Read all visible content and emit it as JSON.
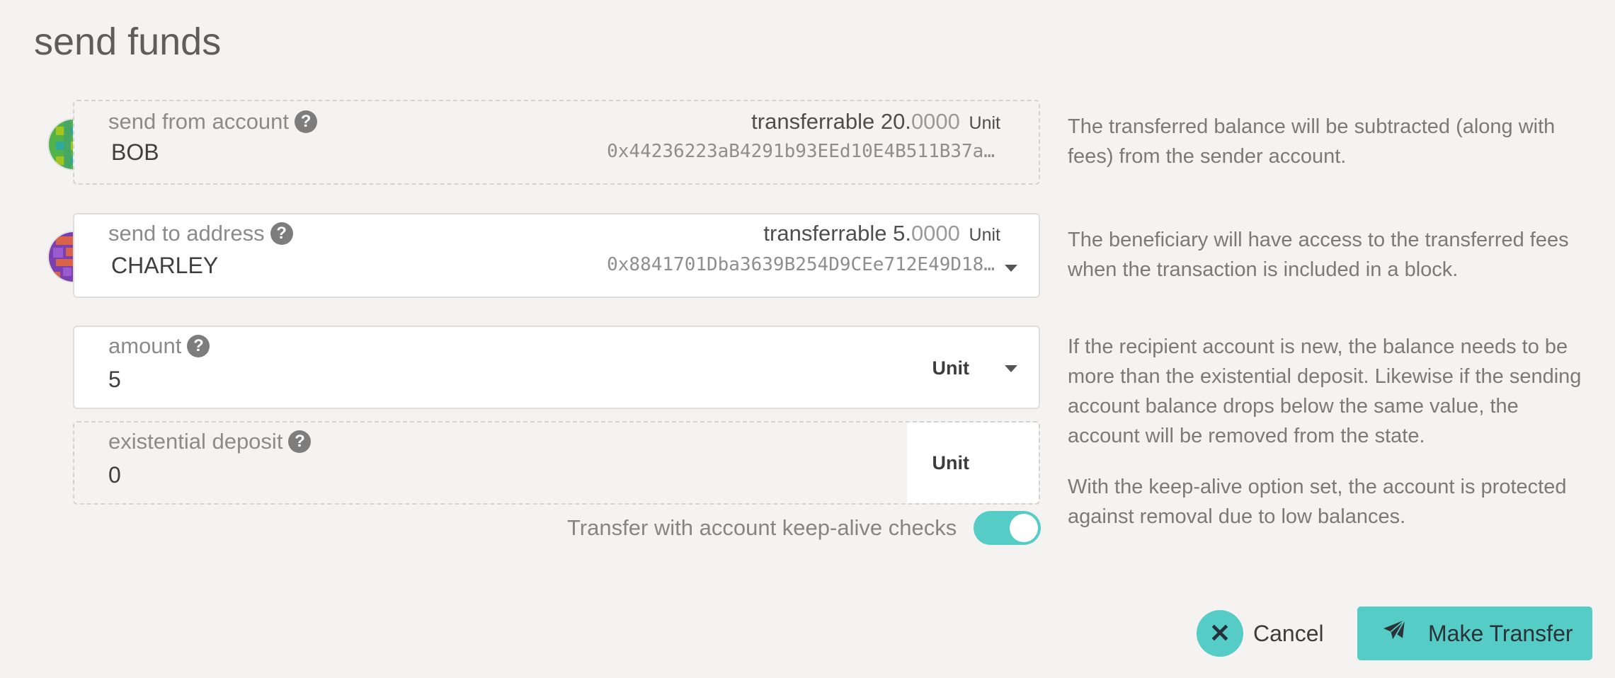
{
  "page": {
    "title": "send funds"
  },
  "from": {
    "label": "send from account",
    "name": "BOB",
    "transferrable_label": "transferrable",
    "balance_int": "20.",
    "balance_dec": "0000",
    "unit": "Unit",
    "address": "0x44236223aB4291b93EEd10E4B511B37a…",
    "help": "The transferred balance will be subtracted (along with fees) from the sender account."
  },
  "to": {
    "label": "send to address",
    "name": "CHARLEY",
    "transferrable_label": "transferrable",
    "balance_int": "5.",
    "balance_dec": "0000",
    "unit": "Unit",
    "address": "0x8841701Dba3639B254D9CEe712E49D18…",
    "help": "The beneficiary will have access to the transferred fees when the transaction is included in a block."
  },
  "amount": {
    "label": "amount",
    "value": "5",
    "unit": "Unit",
    "help": "If the recipient account is new, the balance needs to be more than the existential deposit. Likewise if the sending account balance drops below the same value, the account will be removed from the state."
  },
  "deposit": {
    "label": "existential deposit",
    "value": "0",
    "unit": "Unit"
  },
  "keepalive": {
    "label": "Transfer with account keep-alive checks",
    "enabled": true,
    "help": "With the keep-alive option set, the account is protected against removal due to low balances."
  },
  "actions": {
    "cancel": "Cancel",
    "submit": "Make Transfer"
  },
  "colors": {
    "accent": "#55ccc6",
    "background": "#f4f3f1"
  }
}
